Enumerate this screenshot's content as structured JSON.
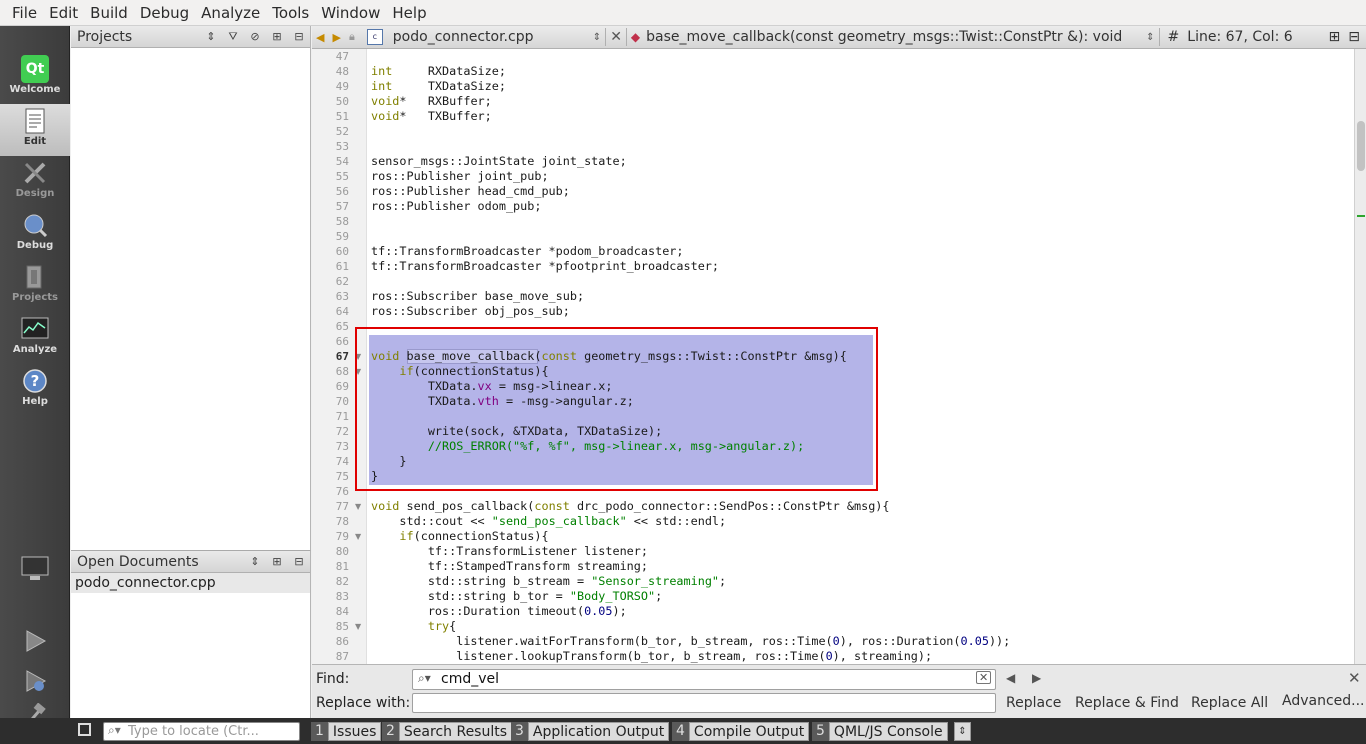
{
  "menu": [
    "File",
    "Edit",
    "Build",
    "Debug",
    "Analyze",
    "Tools",
    "Window",
    "Help"
  ],
  "modes": [
    {
      "label": "Welcome",
      "icon": "qt-logo-icon"
    },
    {
      "label": "Edit",
      "icon": "edit-document-icon"
    },
    {
      "label": "Design",
      "icon": "design-pencil-icon"
    },
    {
      "label": "Debug",
      "icon": "debug-bug-icon"
    },
    {
      "label": "Projects",
      "icon": "projects-wrench-icon"
    },
    {
      "label": "Analyze",
      "icon": "analyze-chart-icon"
    },
    {
      "label": "Help",
      "icon": "help-question-icon"
    }
  ],
  "projects_panel": {
    "title": "Projects"
  },
  "open_documents": {
    "title": "Open Documents",
    "items": [
      "podo_connector.cpp"
    ]
  },
  "editor_toolbar": {
    "file": "podo_connector.cpp",
    "symbol": "base_move_callback(const geometry_msgs::Twist::ConstPtr &): void",
    "position": "Line: 67, Col: 6"
  },
  "lines": [
    47,
    48,
    49,
    50,
    51,
    52,
    53,
    54,
    55,
    56,
    57,
    58,
    59,
    60,
    61,
    62,
    63,
    64,
    65,
    66,
    67,
    68,
    69,
    70,
    71,
    72,
    73,
    74,
    75,
    76,
    77,
    78,
    79,
    80,
    81,
    82,
    83,
    84,
    85,
    86,
    87
  ],
  "current_line": 67,
  "code": {
    "l48": "int     RXDataSize;",
    "l49": "int     TXDataSize;",
    "l50": "void*   RXBuffer;",
    "l51": "void*   TXBuffer;",
    "l54": "sensor_msgs::JointState joint_state;",
    "l55": "ros::Publisher joint_pub;",
    "l56": "ros::Publisher head_cmd_pub;",
    "l57": "ros::Publisher odom_pub;",
    "l60": "tf::TransformBroadcaster *podom_broadcaster;",
    "l61": "tf::TransformBroadcaster *pfootprint_broadcaster;",
    "l63": "ros::Subscriber base_move_sub;",
    "l64": "ros::Subscriber obj_pos_sub;",
    "l67": "void base_move_callback(const geometry_msgs::Twist::ConstPtr &msg){",
    "l68": "    if(connectionStatus){",
    "l69": "        TXData.vx = msg->linear.x;",
    "l70": "        TXData.vth = -msg->angular.z;",
    "l72": "        write(sock, &TXData, TXDataSize);",
    "l73": "        //ROS_ERROR(\"%f, %f\", msg->linear.x, msg->angular.z);",
    "l74": "    }",
    "l75": "}",
    "l77": "void send_pos_callback(const drc_podo_connector::SendPos::ConstPtr &msg){",
    "l78": "    std::cout << \"send_pos_callback\" << std::endl;",
    "l79": "    if(connectionStatus){",
    "l80": "        tf::TransformListener listener;",
    "l81": "        tf::StampedTransform streaming;",
    "l82": "        std::string b_stream = \"Sensor_streaming\";",
    "l83": "        std::string b_tor = \"Body_TORSO\";",
    "l84": "        ros::Duration timeout(0.05);",
    "l85": "        try{",
    "l86": "            listener.waitForTransform(b_tor, b_stream, ros::Time(0), ros::Duration(0.05));",
    "l87": "            listener.lookupTransform(b_tor, b_stream, ros::Time(0), streaming);"
  },
  "find": {
    "find_label": "Find:",
    "find_value": "cmd_vel",
    "replace_label": "Replace with:",
    "replace_value": "",
    "replace": "Replace",
    "replace_find": "Replace & Find",
    "replace_all": "Replace All",
    "advanced": "Advanced..."
  },
  "statusbar": {
    "locator_placeholder": "Type to locate (Ctr...",
    "tabs": [
      {
        "n": "1",
        "label": "Issues"
      },
      {
        "n": "2",
        "label": "Search Results"
      },
      {
        "n": "3",
        "label": "Application Output"
      },
      {
        "n": "4",
        "label": "Compile Output"
      },
      {
        "n": "5",
        "label": "QML/JS Console"
      }
    ]
  },
  "colors": {
    "selection": "#b4b4e8",
    "highlight_box": "#e00000",
    "keyword": "#808000",
    "string": "#008000"
  }
}
